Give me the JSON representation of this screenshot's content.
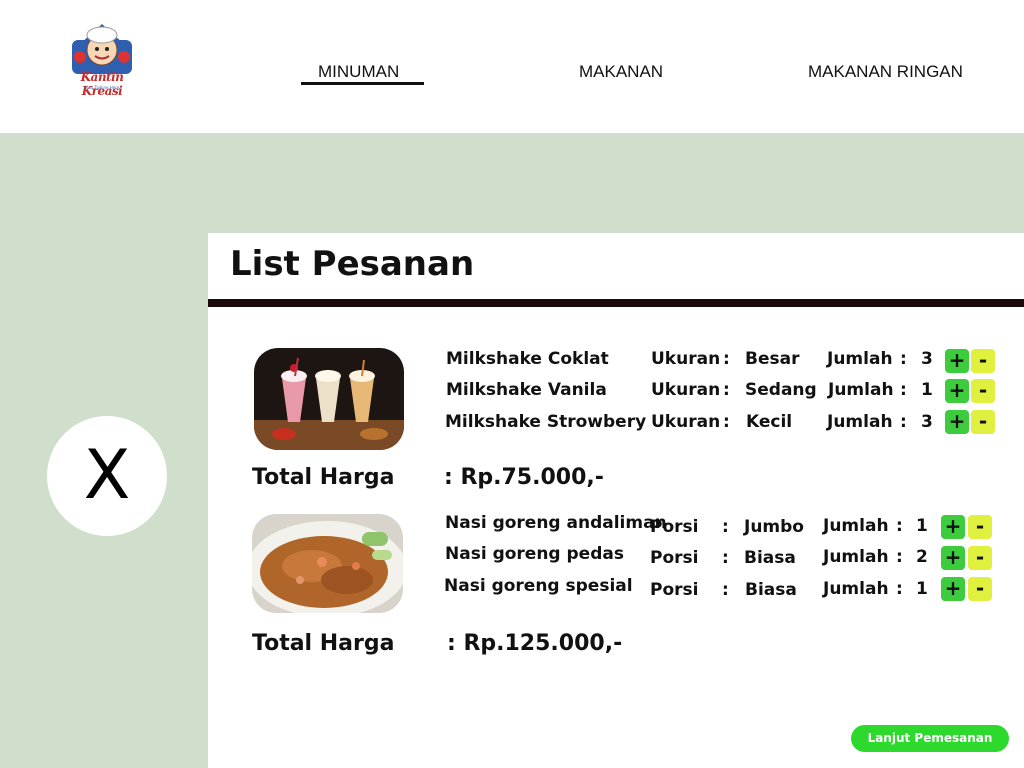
{
  "brand": {
    "name": "Kantin Kreasi",
    "tagline": "Your Tagline Here"
  },
  "nav": {
    "items": [
      {
        "label": "MINUMAN",
        "active": true
      },
      {
        "label": "MAKANAN",
        "active": false
      },
      {
        "label": "MAKANAN RINGAN",
        "active": false
      }
    ]
  },
  "close": {
    "label": "X"
  },
  "panel": {
    "title": "List Pesanan"
  },
  "orders": [
    {
      "image": "milkshake-photo",
      "items": [
        {
          "name": "Milkshake Coklat",
          "attr_label": "Ukuran",
          "attr_value": "Besar",
          "qty_label": "Jumlah",
          "qty": "3"
        },
        {
          "name": "Milkshake Vanila",
          "attr_label": "Ukuran",
          "attr_value": "Sedang",
          "qty_label": "Jumlah",
          "qty": "1"
        },
        {
          "name": "Milkshake Strowbery",
          "attr_label": "Ukuran",
          "attr_value": "Kecil",
          "qty_label": "Jumlah",
          "qty": "3"
        }
      ],
      "total_label": "Total Harga",
      "total_value": ": Rp.75.000,-"
    },
    {
      "image": "fried-rice-photo",
      "items": [
        {
          "name": "Nasi goreng andaliman",
          "attr_label": "Porsi",
          "attr_value": "Jumbo",
          "qty_label": "Jumlah",
          "qty": "1"
        },
        {
          "name": "Nasi goreng pedas",
          "attr_label": "Porsi",
          "attr_value": "Biasa",
          "qty_label": "Jumlah",
          "qty": "2"
        },
        {
          "name": "Nasi goreng spesial",
          "attr_label": "Porsi",
          "attr_value": "Biasa",
          "qty_label": "Jumlah",
          "qty": "1"
        }
      ],
      "total_label": "Total Harga",
      "total_value": ": Rp.125.000,-"
    }
  ],
  "controls": {
    "plus": "+",
    "minus": "-",
    "colon": ":"
  },
  "cta": {
    "label": "Lanjut Pemesanan"
  },
  "colors": {
    "background": "#cfdfcc",
    "plus": "#3dcc3d",
    "minus": "#dff03e",
    "cta": "#2dd92d"
  }
}
